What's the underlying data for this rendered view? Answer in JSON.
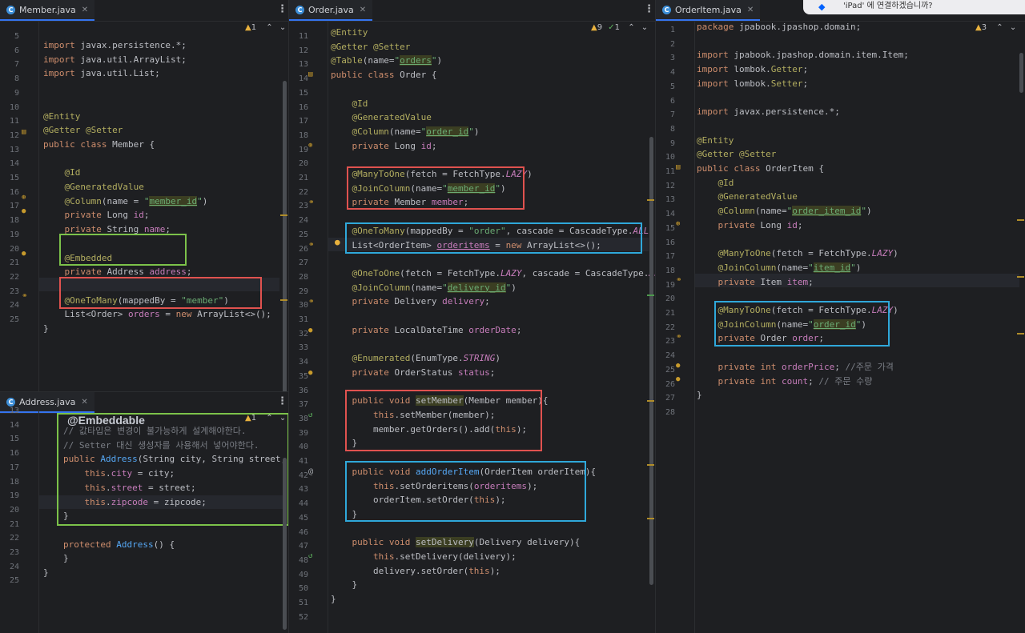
{
  "panes": {
    "member": {
      "tab": "Member.java",
      "inspect": {
        "warnings": "1"
      },
      "line_numbers": [
        "5",
        "6",
        "7",
        "8",
        "9",
        "10",
        "11",
        "12",
        "13",
        "14",
        "15",
        "16",
        "17",
        "18",
        "19",
        "20",
        "21",
        "22",
        "23",
        "24",
        "25"
      ]
    },
    "address": {
      "tab": "Address.java",
      "inspect": {
        "warnings": "1"
      },
      "overlay_label": "@Embeddable",
      "line_numbers": [
        "13",
        "14",
        "15",
        "16",
        "17",
        "18",
        "19",
        "20",
        "21",
        "22",
        "23",
        "24",
        "25"
      ]
    },
    "order": {
      "tab": "Order.java",
      "inspect": {
        "warnings": "9",
        "ok": "1"
      },
      "line_numbers": [
        "11",
        "12",
        "13",
        "14",
        "15",
        "16",
        "17",
        "18",
        "19",
        "20",
        "21",
        "22",
        "23",
        "24",
        "25",
        "26",
        "27",
        "28",
        "29",
        "30",
        "31",
        "32",
        "33",
        "34",
        "35",
        "36",
        "37",
        "38",
        "39",
        "40",
        "41",
        "42",
        "43",
        "44",
        "45",
        "46",
        "47",
        "48",
        "49",
        "50",
        "51",
        "52"
      ]
    },
    "orderitem": {
      "tab": "OrderItem.java",
      "inspect": {
        "warnings": "3"
      },
      "line_numbers": [
        "1",
        "2",
        "3",
        "4",
        "5",
        "6",
        "7",
        "8",
        "9",
        "10",
        "11",
        "12",
        "13",
        "14",
        "15",
        "16",
        "17",
        "18",
        "19",
        "20",
        "21",
        "22",
        "23",
        "24",
        "25",
        "26",
        "27",
        "28"
      ]
    }
  },
  "notification": {
    "text": "'iPad' 에 연결하겠습니까?"
  },
  "colors": {
    "red_box": "#e0524f",
    "blue_box": "#2fa8da",
    "green_box": "#7cc24a",
    "tab_accent": "#3574f0"
  }
}
